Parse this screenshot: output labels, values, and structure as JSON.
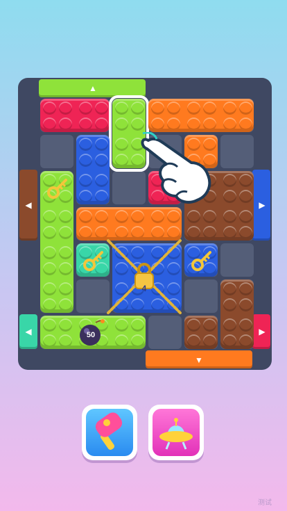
{
  "palette": {
    "frame": "#3f4862",
    "empty_cell": "#545e78",
    "green": "#8fe23a",
    "blue": "#2b5fe0",
    "orange": "#ff7a1f",
    "red": "#ef2455",
    "brown": "#8b4a2c",
    "teal": "#39d6a8"
  },
  "board": {
    "cols": 6,
    "rows": 7,
    "blocks": [
      {
        "name": "red-block",
        "color": "red",
        "col": 0,
        "row": 0,
        "w": 2,
        "h": 1
      },
      {
        "name": "green-vertical-block-selected",
        "color": "green",
        "col": 2,
        "row": 0,
        "w": 1,
        "h": 2,
        "selected": true
      },
      {
        "name": "orange-top-block",
        "color": "orange",
        "col": 3,
        "row": 0,
        "w": 3,
        "h": 1
      },
      {
        "name": "orange-small-block",
        "color": "orange",
        "col": 4,
        "row": 1,
        "w": 1,
        "h": 1
      },
      {
        "name": "blue-block",
        "color": "blue",
        "col": 1,
        "row": 1,
        "w": 1,
        "h": 2
      },
      {
        "name": "red-small-block",
        "color": "red",
        "col": 3,
        "row": 2,
        "w": 1,
        "h": 1
      },
      {
        "name": "brown-block",
        "color": "brown",
        "col": 4,
        "row": 2,
        "w": 2,
        "h": 2
      },
      {
        "name": "green-left-block",
        "color": "green",
        "col": 0,
        "row": 2,
        "w": 1,
        "h": 4,
        "key": true
      },
      {
        "name": "orange-middle-block",
        "color": "orange",
        "col": 1,
        "row": 3,
        "w": 3,
        "h": 1
      },
      {
        "name": "teal-block",
        "color": "teal",
        "col": 1,
        "row": 4,
        "w": 1,
        "h": 1,
        "key": true
      },
      {
        "name": "blue-center-block",
        "color": "blue",
        "col": 2,
        "row": 4,
        "w": 2,
        "h": 2,
        "locked": true
      },
      {
        "name": "blue-right-block",
        "color": "blue",
        "col": 4,
        "row": 4,
        "w": 1,
        "h": 1,
        "key": true
      },
      {
        "name": "brown-right-block",
        "color": "brown",
        "col": 5,
        "row": 5,
        "w": 1,
        "h": 2
      },
      {
        "name": "brown-bottom-block",
        "color": "brown",
        "col": 4,
        "row": 6,
        "w": 1,
        "h": 1
      },
      {
        "name": "green-bottom-block",
        "color": "green",
        "col": 0,
        "row": 6,
        "w": 3,
        "h": 1,
        "bomb": true
      }
    ],
    "gates": [
      {
        "name": "top-gate-green",
        "color": "green",
        "side": "top",
        "arrow": "▲"
      },
      {
        "name": "left-gate-brown",
        "color": "brown",
        "side": "left-upper",
        "arrow": "◀"
      },
      {
        "name": "left-gate-teal",
        "color": "teal",
        "side": "left-lower",
        "arrow": "◀"
      },
      {
        "name": "right-gate-blue",
        "color": "blue",
        "side": "right-upper",
        "arrow": "▶"
      },
      {
        "name": "right-gate-red",
        "color": "red",
        "side": "right-lower",
        "arrow": "▶"
      },
      {
        "name": "bottom-gate-orange",
        "color": "orange",
        "side": "bottom",
        "arrow": "▼"
      }
    ],
    "lock_count": "4",
    "bomb_count": "50"
  },
  "boosters": [
    {
      "name": "hammer-booster",
      "icon": "hammer-icon"
    },
    {
      "name": "ufo-booster",
      "icon": "ufo-icon"
    }
  ],
  "watermark": "测试"
}
